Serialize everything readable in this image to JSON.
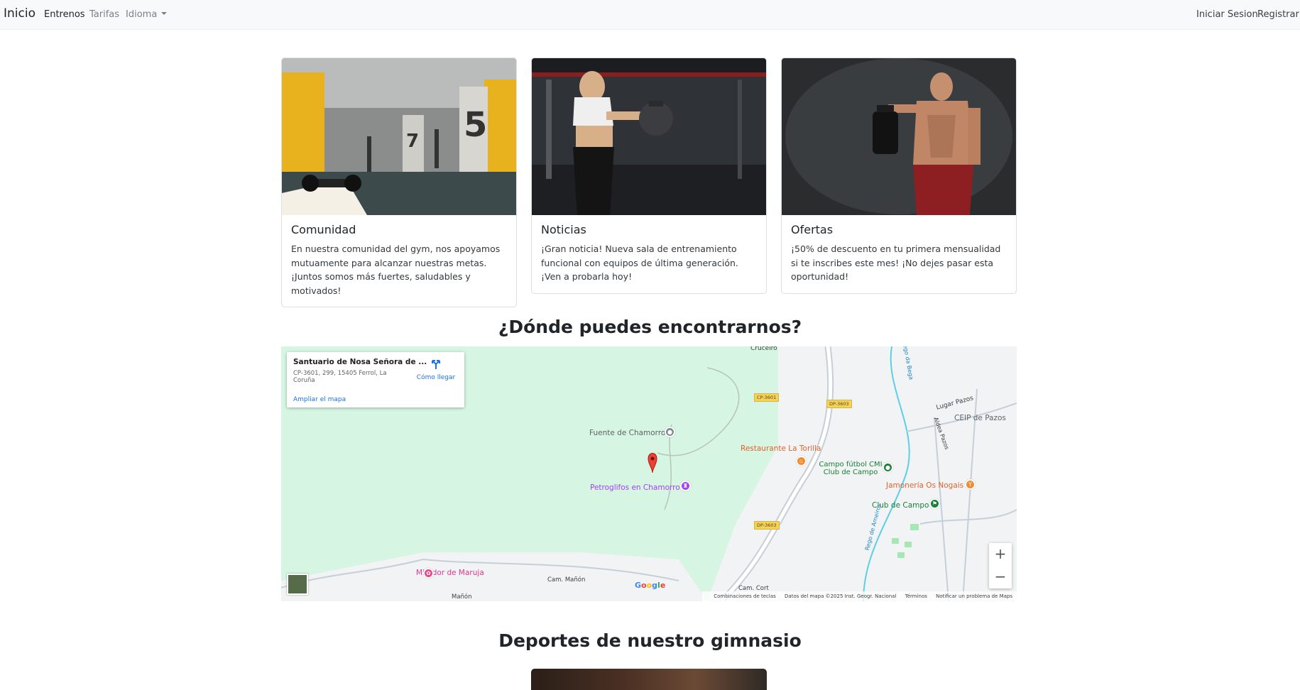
{
  "navbar": {
    "brand": "Inicio",
    "links": [
      "Entrenos",
      "Tarifas",
      "Idioma"
    ],
    "right": [
      "Iniciar Sesion",
      "Registrar"
    ]
  },
  "cards": [
    {
      "title": "Comunidad",
      "text": "En nuestra comunidad del gym, nos apoyamos mutuamente para alcanzar nuestras metas. ¡Juntos somos más fuertes, saludables y motivados!",
      "image": "gym-interior-photo"
    },
    {
      "title": "Noticias",
      "text": "¡Gran noticia! Nueva sala de entrenamiento funcional con equipos de última generación. ¡Ven a probarla hoy!",
      "image": "kettlebell-training-photo"
    },
    {
      "title": "Ofertas",
      "text": "¡50% de descuento en tu primera mensualidad si te inscribes este mes! ¡No dejes pasar esta oportunidad!",
      "image": "athlete-supplement-photo"
    }
  ],
  "location": {
    "heading": "¿Dónde puedes encontrarnos?"
  },
  "map": {
    "place_name": "Santuario de Nosa Señora de ...",
    "address": "CP-3601, 299, 15405 Ferrol, La Coruña",
    "enlarge_link": "Ampliar el mapa",
    "directions_label": "Cómo llegar",
    "labels": {
      "cruceiro": "Cruceiro",
      "fuente": "Fuente de Chamorro",
      "petroglifos": "Petroglifos en Chamorro",
      "restaurante": "Restaurante La Torilla",
      "campo_futbol": "Campo fútbol CMI Club de Campo",
      "jamoneria": "Jamonería Os Nogais",
      "club_campo": "Club de Campo",
      "ceip": "CEIP de Pazos",
      "lugar_pazos": "Lugar Pazos",
      "aldea_pazos": "Aldea Pazos",
      "mirador": "Mirador de Maruja",
      "cam_manon": "Cam. Mañón",
      "manon": "Mañón",
      "cam_cort": "Cam. Cort",
      "rego_bega": "Rego da Bega",
      "rego_ameiros": "Rego de Ameiros"
    },
    "road_tags": [
      "CP-3601",
      "DP-3603",
      "DP-3603"
    ],
    "footer": [
      "Combinaciones de teclas",
      "Datos del mapa ©2025 Inst. Geogr. Nacional",
      "Términos",
      "Notificar un problema de Maps"
    ],
    "logo": "Google",
    "zoom_in": "+",
    "zoom_out": "−"
  },
  "sports": {
    "heading": "Deportes de nuestro gimnasio"
  }
}
